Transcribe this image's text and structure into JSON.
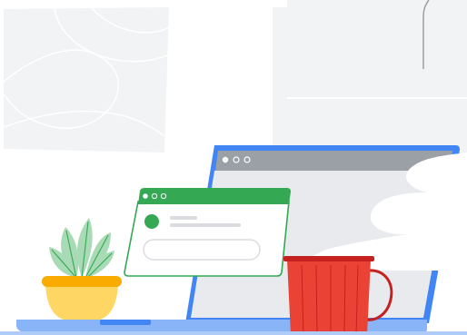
{
  "scene": {
    "description_free": true
  },
  "colors": {
    "background": "#ffffff",
    "wall_panel": "#f1f3f4",
    "wall_panel_lines": "#ffffff",
    "laptop_frame": "#4285f4",
    "laptop_frame_dark": "#1a73e8",
    "laptop_titlebar": "#9aa0a6",
    "laptop_screen": "#e8eaed",
    "laptop_base": "#8ab4f8",
    "window_titlebar": "#34a853",
    "window_body": "#ffffff",
    "window_border": "#34a853",
    "window_avatar": "#34a853",
    "window_lines": "#dadce0",
    "mug": "#ea4335",
    "mug_rim": "#c5221f",
    "steam": "#ffffff",
    "plant_leaves": "#a8dab5",
    "plant_leaf_lines": "#34a853",
    "pot": "#fdd663",
    "pot_rim": "#f9ab00",
    "desk": "#aecbfa"
  },
  "icons": {
    "laptop_window_dots": "window-dots-icon",
    "popup_window_dots": "window-dots-icon",
    "avatar": "avatar-icon",
    "plant": "plant-icon",
    "mug": "mug-icon"
  }
}
